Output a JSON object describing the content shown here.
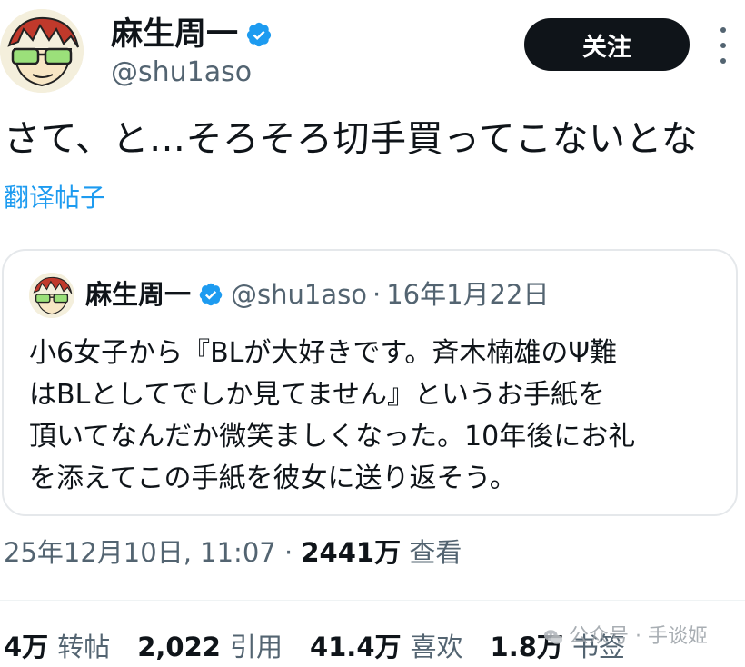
{
  "author": {
    "name": "麻生周一",
    "handle": "@shu1aso"
  },
  "follow_button": {
    "label": "关注"
  },
  "tweet": {
    "text": "さて、と…そろそろ切手買ってこないとな",
    "translate_label": "翻译帖子",
    "timestamp": "25年12月10日, 11:07",
    "separator": "·",
    "views_count": "2441万",
    "views_label": "查看"
  },
  "quoted_tweet": {
    "name": "麻生周一",
    "handle": "@shu1aso",
    "separator": "·",
    "date": "16年1月22日",
    "lines": [
      "小6女子から『BLが大好きです。斉木楠雄のΨ難",
      "はBLとしてでしか見てません』というお手紙を",
      "頂いてなんだか微笑ましくなった。10年後にお礼",
      "を添えてこの手紙を彼女に送り返そう。"
    ]
  },
  "stats": [
    {
      "count": "4万",
      "label": "转帖"
    },
    {
      "count": "2,022",
      "label": "引用"
    },
    {
      "count": "41.4万",
      "label": "喜欢"
    },
    {
      "count": "1.8万",
      "label": "书签"
    }
  ],
  "watermark": {
    "text": "公众号 · 手谈姬"
  },
  "colors": {
    "verified_blue": "#1d9bf0",
    "link_blue": "#1d9bf0",
    "text_primary": "#0f1419",
    "text_secondary": "#536471",
    "follow_bg": "#0f1419"
  },
  "icons": {
    "verified": "verified-badge-icon",
    "more": "more-options-icon",
    "watermark": "wechat-icon"
  }
}
